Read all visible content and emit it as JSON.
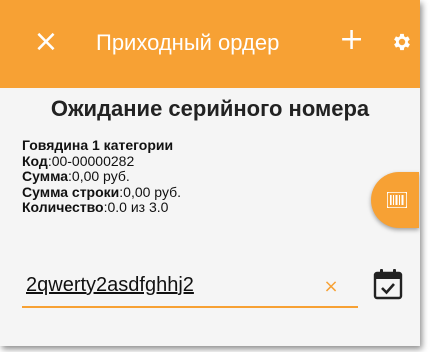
{
  "appbar": {
    "title": "Приходный ордер",
    "background": "#f7a134",
    "icons": {
      "close": "close-icon",
      "add": "plus-icon",
      "settings": "gear-icon"
    }
  },
  "main": {
    "heading": "Ожидание серийного номера",
    "product_name": "Говядина 1 категории",
    "fields": [
      {
        "label": "Код",
        "value": ":00-00000282"
      },
      {
        "label": "Сумма",
        "value": ":0,00 руб."
      },
      {
        "label": "Сумма строки",
        "value": ":0,00 руб."
      },
      {
        "label": "Количество",
        "value": ":0.0 из 3.0"
      }
    ]
  },
  "serial_input": {
    "value": "2qwerty2asdfghhj2",
    "clear_symbol": "×"
  },
  "buttons": {
    "scan": "barcode-icon",
    "confirm": "calendar-check-icon"
  },
  "colors": {
    "accent": "#f7a134",
    "background": "#f5f5f5"
  }
}
